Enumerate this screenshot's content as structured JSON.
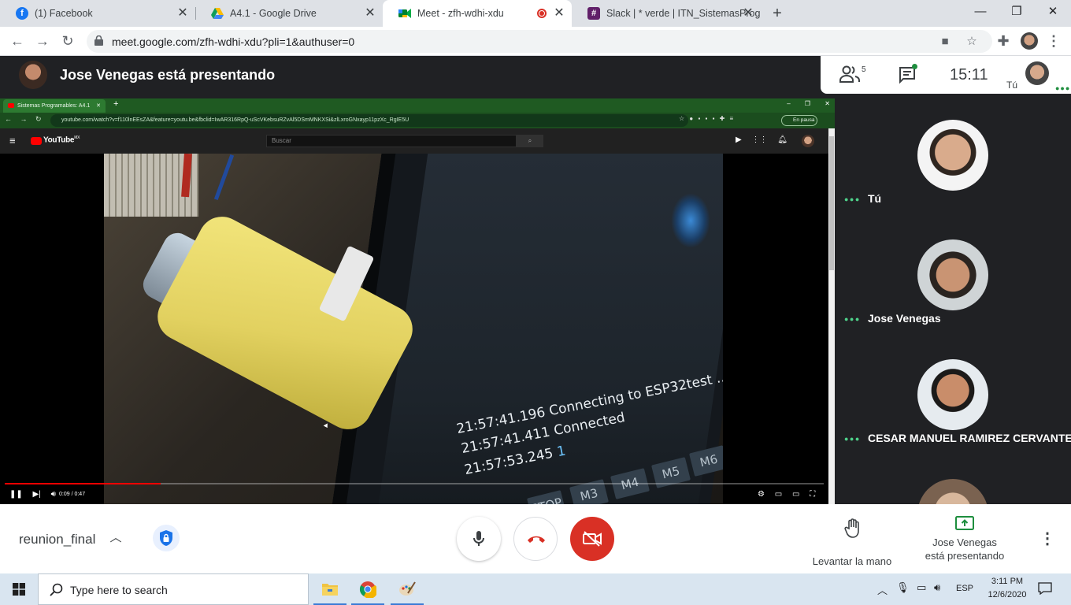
{
  "browser": {
    "tabs": [
      {
        "title": "(1) Facebook",
        "icon": "facebook-icon",
        "active": false
      },
      {
        "title": "A4.1 - Google Drive",
        "icon": "google-drive-icon",
        "active": false
      },
      {
        "title": "Meet - zfh-wdhi-xdu",
        "icon": "google-meet-icon",
        "active": true,
        "recording": true
      },
      {
        "title": "Slack | * verde | ITN_SistemasProg",
        "icon": "slack-icon",
        "active": false
      }
    ],
    "new_tab_label": "+",
    "url": "meet.google.com/zfh-wdhi-xdu?pli=1&authuser=0"
  },
  "meet": {
    "presenter_title": "Jose Venegas está presentando",
    "participant_count": "5",
    "clock": "15:11",
    "self_label": "Tú",
    "meeting_name": "reunion_final",
    "raise_hand_label": "Levantar la mano",
    "presenting_label_line1": "Jose Venegas",
    "presenting_label_line2": "está presentando",
    "participants": [
      {
        "name": "Tú"
      },
      {
        "name": "Jose Venegas"
      },
      {
        "name": "CESAR MANUEL RAMIREZ CERVANTES"
      },
      {
        "name": ""
      }
    ],
    "colors": {
      "accent_green": "#1e8e3e",
      "hangup_red": "#d93025",
      "dots_green": "#4ed38b"
    }
  },
  "shared_screen": {
    "inner_tab_title": "Sistemas Programables: A4.1",
    "inner_url": "youtube.com/watch?v=f110lnEEsZA&feature=youtu.be&fbclid=IwAR316RpQ-uScVKebsuRZvAl5DSmMNKXSi&zlLxroGNxayp11pzXc_RgIE5U",
    "paused_label": "En pausa",
    "youtube_logo": "YouTube",
    "youtube_region": "MX",
    "search_placeholder": "Buscar",
    "video_time": "0:09 / 0:47",
    "progress_fraction": 0.19,
    "serial_lines": [
      {
        "time": "21:57:41.196",
        "text": "Connecting to ESP32test ..."
      },
      {
        "time": "21:57:41.411",
        "text": "Connected"
      },
      {
        "time": "21:57:53.245",
        "text": "1"
      }
    ],
    "buttons": [
      "STOP",
      "M3",
      "M4",
      "M5",
      "M6"
    ]
  },
  "taskbar": {
    "search_placeholder": "Type here to search",
    "language": "ESP",
    "time": "3:11 PM",
    "date": "12/6/2020"
  }
}
